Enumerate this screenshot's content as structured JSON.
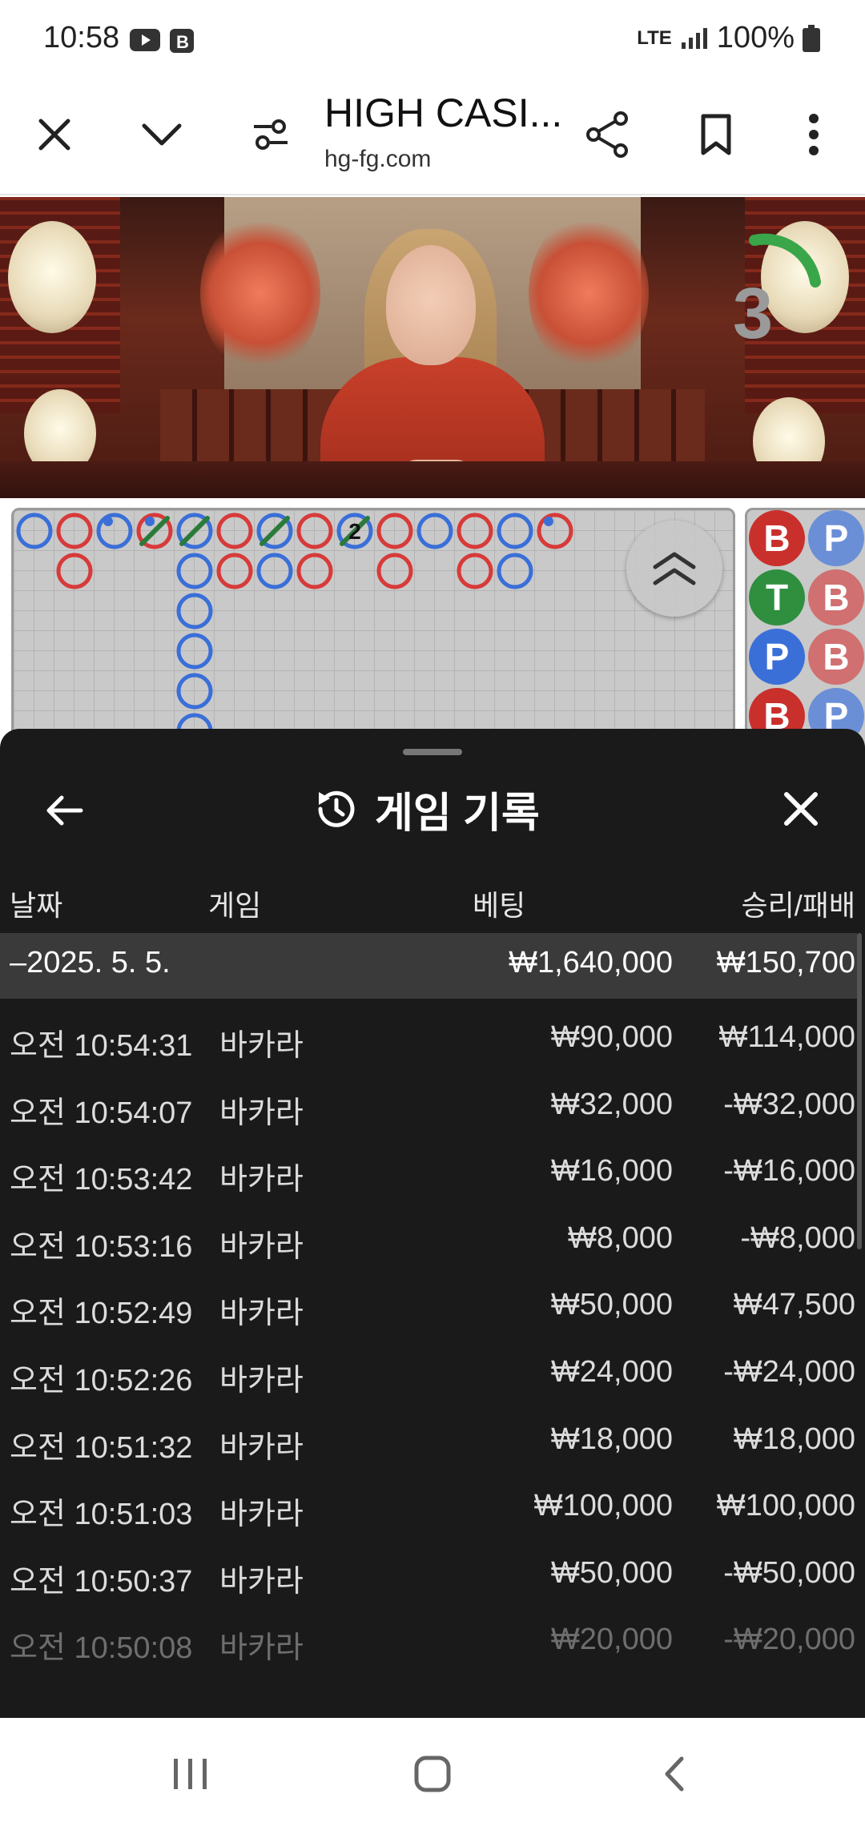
{
  "status_bar": {
    "time": "10:58",
    "network": "LTE",
    "battery": "100%"
  },
  "browser": {
    "title": "HIGH CASI...",
    "domain": "hg-fg.com"
  },
  "video": {
    "countdown": "3"
  },
  "bead_road": {
    "marker_number": "2"
  },
  "side_road": [
    "B",
    "P",
    "T",
    "B",
    "P",
    "B",
    "B",
    "P"
  ],
  "sheet": {
    "title": "게임 기록",
    "columns": {
      "date": "날짜",
      "game": "게임",
      "bet": "베팅",
      "result": "승리/패배"
    },
    "summary": {
      "date": "–2025. 5. 5.",
      "bet": "₩1,640,000",
      "result": "₩150,700"
    },
    "rows": [
      {
        "time": "오전 10:54:31",
        "game": "바카라",
        "bet": "₩90,000",
        "result": "₩114,000"
      },
      {
        "time": "오전 10:54:07",
        "game": "바카라",
        "bet": "₩32,000",
        "result": "-₩32,000"
      },
      {
        "time": "오전 10:53:42",
        "game": "바카라",
        "bet": "₩16,000",
        "result": "-₩16,000"
      },
      {
        "time": "오전 10:53:16",
        "game": "바카라",
        "bet": "₩8,000",
        "result": "-₩8,000"
      },
      {
        "time": "오전 10:52:49",
        "game": "바카라",
        "bet": "₩50,000",
        "result": "₩47,500"
      },
      {
        "time": "오전 10:52:26",
        "game": "바카라",
        "bet": "₩24,000",
        "result": "-₩24,000"
      },
      {
        "time": "오전 10:51:32",
        "game": "바카라",
        "bet": "₩18,000",
        "result": "₩18,000"
      },
      {
        "time": "오전 10:51:03",
        "game": "바카라",
        "bet": "₩100,000",
        "result": "₩100,000"
      },
      {
        "time": "오전 10:50:37",
        "game": "바카라",
        "bet": "₩50,000",
        "result": "-₩50,000"
      },
      {
        "time": "오전 10:50:08",
        "game": "바카라",
        "bet": "₩20,000",
        "result": "-₩20,000"
      }
    ]
  }
}
